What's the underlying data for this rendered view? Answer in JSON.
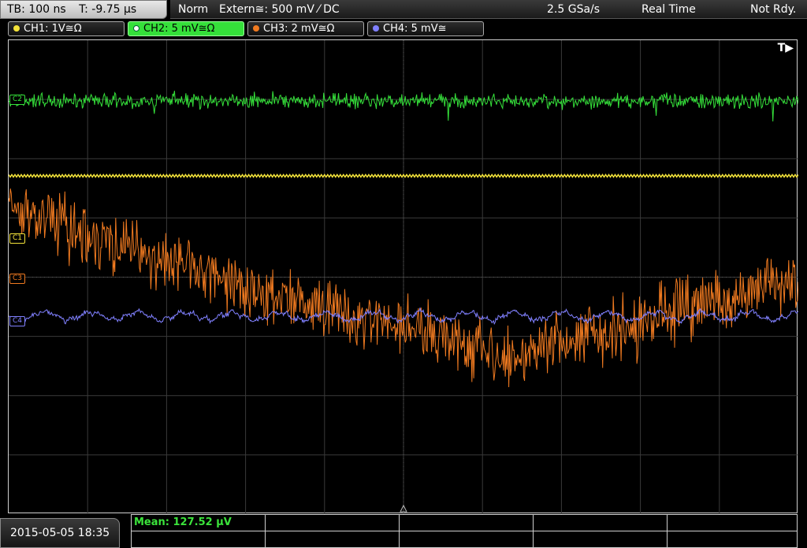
{
  "status": {
    "timebase": "TB: 100 ns",
    "trigger_time": "T: -9.75 µs",
    "trigger_mode": "Norm",
    "trigger_source": "Extern≅: 500 mV ⁄ DC",
    "sample_rate": "2.5 GSa/s",
    "acq_mode": "Real Time",
    "acq_state": "Not Rdy."
  },
  "channels": [
    {
      "label": "CH1: 1V≅Ω",
      "color": "#f5e43a"
    },
    {
      "label": "CH2: 5 mV≅Ω",
      "color": "#35e03a"
    },
    {
      "label": "CH3: 2 mV≅Ω",
      "color": "#f07a20"
    },
    {
      "label": "CH4: 5 mV≅",
      "color": "#8080ff"
    }
  ],
  "markers": {
    "c1": "C1",
    "c2": "C2",
    "c3": "C3",
    "c4": "C4",
    "trigger": "T▶"
  },
  "measurement": {
    "mean": "Mean: 127.52 µV"
  },
  "datetime": "2015-05-05 18:35",
  "colors": {
    "ch1": "#f5e43a",
    "ch2": "#35e03a",
    "ch3": "#f07a20",
    "ch4": "#8080ff",
    "grid": "#3a3a3a"
  }
}
